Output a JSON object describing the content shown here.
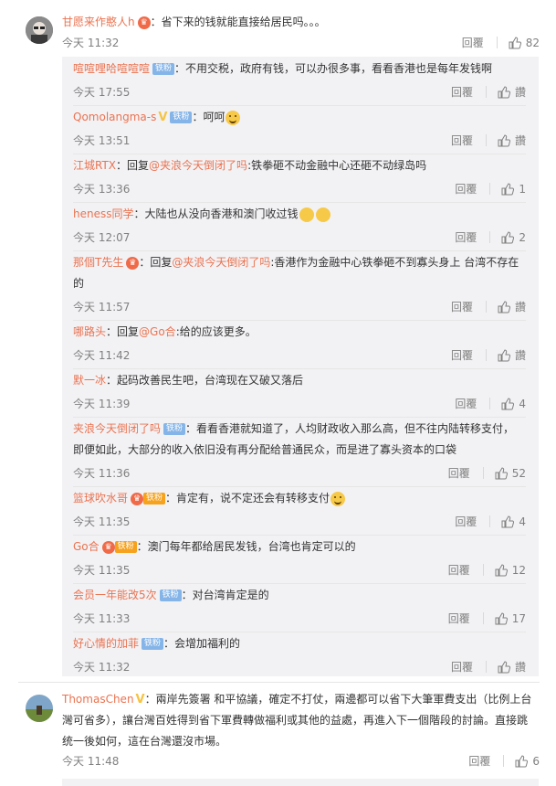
{
  "labels": {
    "reply": "回覆",
    "like_placeholder": "讚"
  },
  "comments": [
    {
      "user": "甘愿来作憨人h",
      "text": "：省下来的钱就能直接给居民吗。。。",
      "time": "今天 11:32",
      "likes": "82",
      "replies": [
        {
          "user": "喧喧哩哈喧喧喧",
          "badge": "铁粉",
          "text": "：不用交税，政府有钱，可以办很多事，看看香港也是每年发钱啊",
          "time": "今天 17:55",
          "likes": "讚"
        },
        {
          "user": "Qomolangma-s",
          "badge": "铁粉",
          "text": "：呵呵",
          "time": "今天 13:51",
          "likes": "讚"
        },
        {
          "user": "江城RTX",
          "text": "：回复",
          "mention": "@夹浪今天倒闭了吗",
          "text2": ":铁拳砸不动金融中心还砸不动绿岛吗",
          "time": "今天 13:36",
          "likes": "1"
        },
        {
          "user": "heness同学",
          "text": "：大陆也从没向香港和澳门收过钱",
          "time": "今天 12:07",
          "likes": "2"
        },
        {
          "user": "那個T先生",
          "text": "：回复",
          "mention": "@夹浪今天倒闭了吗",
          "text2": ":香港作为金融中心铁拳砸不到寡头身上 台湾不存在",
          "text3": "的",
          "time": "今天 11:57",
          "likes": "讚"
        },
        {
          "user": "哪路头",
          "text": "：回复",
          "mention": "@Go合",
          "text2": ":给的应该更多。",
          "time": "今天 11:42",
          "likes": "讚"
        },
        {
          "user": "默一冰",
          "text": "：起码改善民生吧，台湾现在又破又落后",
          "time": "今天 11:39",
          "likes": "4"
        },
        {
          "user": "夹浪今天倒闭了吗",
          "badge": "铁粉",
          "text": "：看看香港就知道了，人均财政收入那么高，但不往内陆转移支付，",
          "text3": "即便如此，大部分的收入依旧没有再分配给普通民众，而是进了寡头资本的口袋",
          "time": "今天 11:36",
          "likes": "52"
        },
        {
          "user": "篮球吹水哥",
          "medal": "铁粉",
          "text": "：肯定有，说不定还会有转移支付",
          "time": "今天 11:35",
          "likes": "4"
        },
        {
          "user": "Go合",
          "medal": "铁粉",
          "text": "：澳门每年都给居民发钱，台湾也肯定可以的",
          "time": "今天 11:35",
          "likes": "12"
        },
        {
          "user": "会员一年能改5次",
          "badge": "铁粉",
          "text": "：对台湾肯定是的",
          "time": "今天 11:33",
          "likes": "17"
        },
        {
          "user": "好心情的加菲",
          "badge": "铁粉",
          "text": "：会增加福利的",
          "time": "今天 11:32",
          "likes": "讚"
        }
      ]
    },
    {
      "user": "ThomasChen",
      "text": "：兩岸先簽署 和平協議，確定不打仗，兩邊都可以省下大筆軍費支出（比例上台",
      "text_line2": "灣可省多），讓台灣百姓得到省下軍費轉做福利或其他的益處，再進入下一個階段的討論。直接跳",
      "text_line3": "统一後如何，這在台灣還沒市場。",
      "time": "今天 11:48",
      "likes": "6"
    }
  ],
  "colors": {
    "username": "#eb7350",
    "reply_bg": "#f2f2f5",
    "meta": "#808080",
    "badge": "#85b5e8"
  },
  "icons": [
    "thumb-up-icon",
    "vip-icon",
    "verified-v-icon",
    "smile-emoji-icon"
  ]
}
